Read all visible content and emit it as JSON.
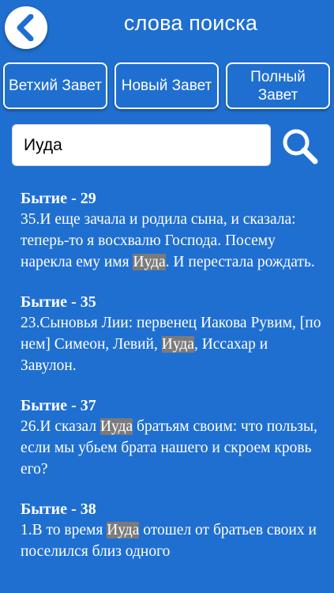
{
  "header": {
    "title": "слова поиска",
    "back_icon": "chevron-left-icon"
  },
  "segments": [
    {
      "label": "Ветхий Завет"
    },
    {
      "label": "Новый Завет"
    },
    {
      "line1": "Полный",
      "line2": "Завет"
    }
  ],
  "search": {
    "value": "Иуда",
    "icon": "search-icon"
  },
  "results": [
    {
      "title": "Бытие - 29",
      "before": "35.И еще зачала и родила сына, и сказала: теперь-то я восхвалю Господа. Посему нарекла ему имя ",
      "highlight": "Иуда",
      "after": ". И перестала рождать."
    },
    {
      "title": "Бытие - 35",
      "before": "23.Сыновья Лии: первенец Иакова Рувим, [по нем] Симеон, Левий, ",
      "highlight": "Иуда",
      "after": ", Иссахар и Завулон."
    },
    {
      "title": "Бытие - 37",
      "before": "26.И сказал ",
      "highlight": "Иуда",
      "after": " братьям своим: что пользы, если мы убьем брата нашего и скроем кровь его?"
    },
    {
      "title": "Бытие - 38",
      "before": "1.В то время ",
      "highlight": "Иуда",
      "after": " отошел от братьев своих и поселился близ одного"
    }
  ],
  "colors": {
    "background": "#1f6fd0",
    "highlight": "#7b7b7b",
    "text": "#ffffff"
  }
}
